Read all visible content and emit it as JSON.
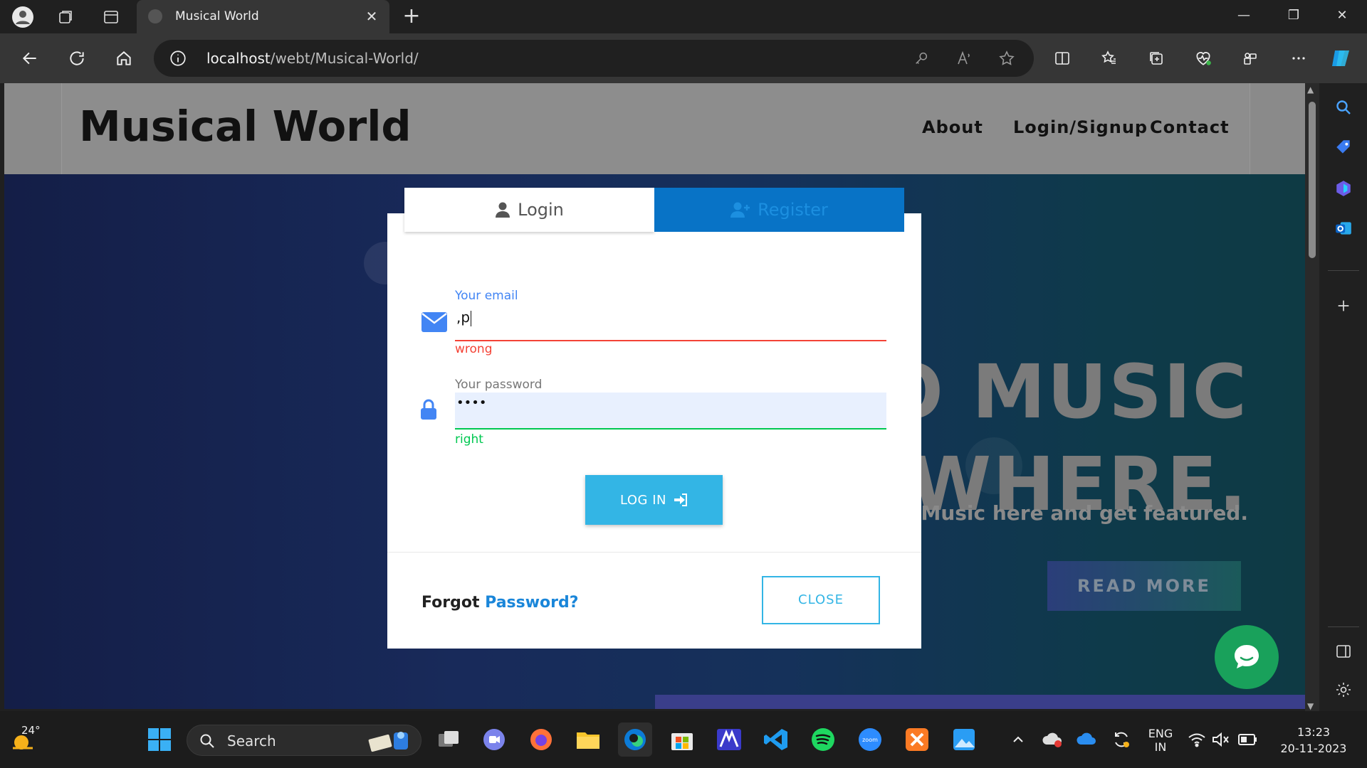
{
  "browser": {
    "tab_title": "Musical World",
    "address_host": "localhost",
    "address_path": "/webt/Musical-World/"
  },
  "site": {
    "brand": "Musical World",
    "nav": [
      "About",
      "Login/Signup",
      "Contact"
    ],
    "hero_line1": "O MUSIC",
    "hero_line2": "YWHERE.",
    "hero_sub": "Your Music here and get featured.",
    "read_more": "READ MORE"
  },
  "modal": {
    "tab_login": "Login",
    "tab_register": "Register",
    "email_label": "Your email",
    "email_value": ",p",
    "email_msg": "wrong",
    "password_label": "Your password",
    "password_value": "••••",
    "password_msg": "right",
    "login_button": "LOG IN",
    "forgot_text": "Forgot",
    "forgot_link": "Password?",
    "close_button": "CLOSE"
  },
  "colors": {
    "error": "#f44336",
    "success": "#00c851",
    "accent": "#33b5e5",
    "register_tab": "#0873c6"
  },
  "taskbar": {
    "weather_temp": "24°",
    "search_placeholder": "Search",
    "lang_line1": "ENG",
    "lang_line2": "IN",
    "time": "13:23",
    "date": "20-11-2023"
  }
}
